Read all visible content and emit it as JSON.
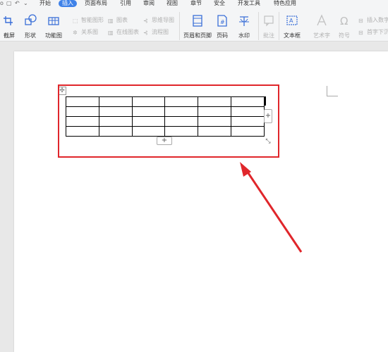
{
  "menubar": {
    "quick_access": [
      "o",
      "▢",
      "↶",
      "⌄"
    ],
    "tabs": [
      "开始",
      "插入",
      "页面布局",
      "引用",
      "审阅",
      "视图",
      "章节",
      "安全",
      "开发工具",
      "特色应用"
    ],
    "active_tab": "插入"
  },
  "ribbon": {
    "screenshot": "截屏",
    "shapes": "形状",
    "function_chart": "功能图",
    "smart_shape": "智能图形",
    "chart": "图表",
    "mind_map": "思维导图",
    "relation_chart": "关系图",
    "online_chart": "在线图表",
    "flowchart": "流程图",
    "header_footer": "页眉和页脚",
    "page_number": "页码",
    "watermark": "水印",
    "comment": "批注",
    "textbox": "文本框",
    "art_text": "艺术字",
    "symbol": "符号",
    "insert_number": "插入数字",
    "first_letter": "首字下沉"
  },
  "table": {
    "rows": 4,
    "cols": 6
  },
  "handles": {
    "move": "✢",
    "add_col": "+",
    "add_row": "+",
    "resize": "⤡"
  },
  "colors": {
    "accent": "#3f82e8",
    "highlight": "#e0262b"
  }
}
